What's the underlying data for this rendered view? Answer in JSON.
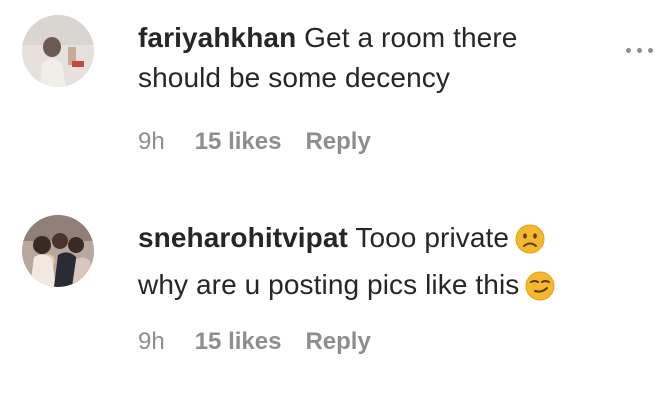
{
  "comments": [
    {
      "username": "fariyahkhan",
      "text": "Get a room there should be some decency",
      "time": "9h",
      "likes": "15 likes",
      "reply_label": "Reply",
      "avatar_icon": "profile-photo-avatar"
    },
    {
      "username": "sneharohitvipat",
      "text_part1": "Tooo private",
      "text_part2": "why are u posting pics like this",
      "emoji1": "slightly-frowning-face-emoji",
      "emoji2": "smirking-face-emoji",
      "time": "9h",
      "likes": "15 likes",
      "reply_label": "Reply",
      "avatar_icon": "profile-photo-avatar"
    }
  ],
  "more_options_icon": "more-options-icon",
  "colors": {
    "username": "#262626",
    "meta": "#8e8e8e",
    "emoji": "#f5b72c"
  }
}
